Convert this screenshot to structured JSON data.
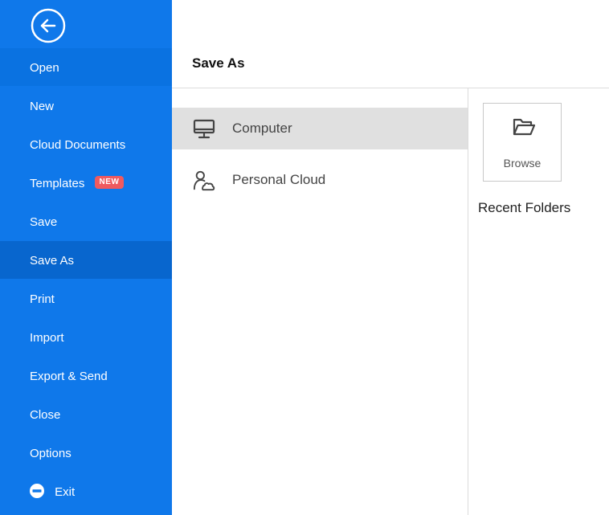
{
  "sidebar": {
    "back_icon": "arrow-left-circle-icon",
    "items": [
      {
        "label": "Open",
        "state": "hover"
      },
      {
        "label": "New"
      },
      {
        "label": "Cloud Documents"
      },
      {
        "label": "Templates",
        "badge": "NEW"
      },
      {
        "label": "Save"
      },
      {
        "label": "Save As",
        "state": "active"
      },
      {
        "label": "Print"
      },
      {
        "label": "Import"
      },
      {
        "label": "Export & Send"
      },
      {
        "label": "Close"
      },
      {
        "label": "Options"
      },
      {
        "label": "Exit",
        "icon": "minus-circle-icon"
      }
    ]
  },
  "main": {
    "title": "Save As",
    "locations": [
      {
        "label": "Computer",
        "icon": "monitor-icon",
        "selected": true
      },
      {
        "label": "Personal Cloud",
        "icon": "user-cloud-icon"
      }
    ],
    "browse_label": "Browse",
    "browse_icon": "folder-open-icon",
    "recent_title": "Recent Folders"
  },
  "colors": {
    "sidebar_bg": "#0f78ea",
    "sidebar_active": "#0866ce",
    "badge": "#ef5a5f",
    "selected_location": "#e0e0e0"
  }
}
